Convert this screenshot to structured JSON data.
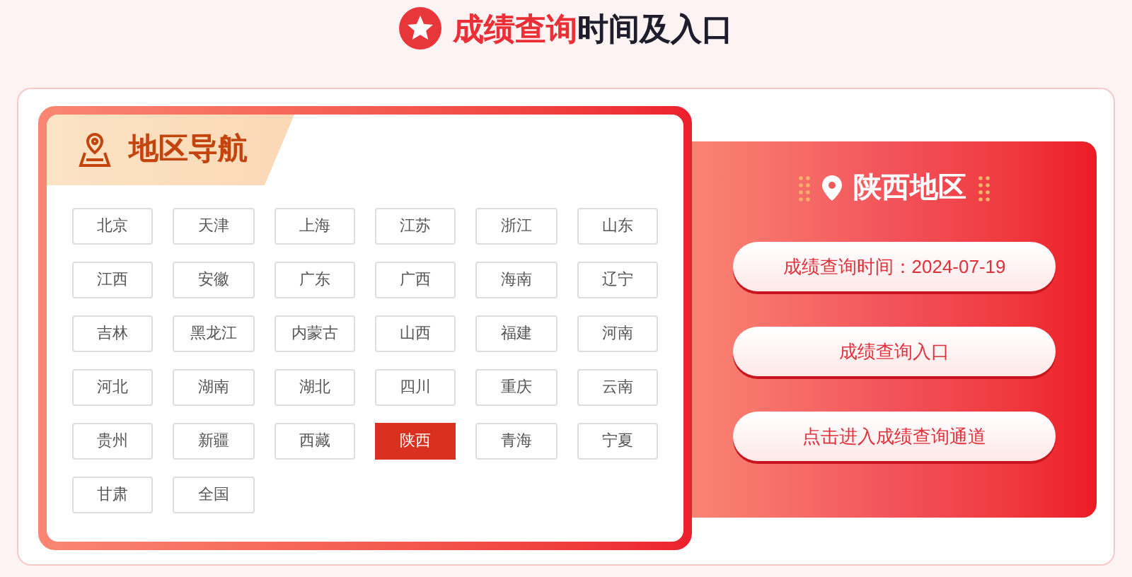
{
  "heading": {
    "highlight": "成绩查询",
    "rest": "时间及入口"
  },
  "region_nav": {
    "title": "地区导航",
    "regions": [
      {
        "name": "北京",
        "selected": false
      },
      {
        "name": "天津",
        "selected": false
      },
      {
        "name": "上海",
        "selected": false
      },
      {
        "name": "江苏",
        "selected": false
      },
      {
        "name": "浙江",
        "selected": false
      },
      {
        "name": "山东",
        "selected": false
      },
      {
        "name": "江西",
        "selected": false
      },
      {
        "name": "安徽",
        "selected": false
      },
      {
        "name": "广东",
        "selected": false
      },
      {
        "name": "广西",
        "selected": false
      },
      {
        "name": "海南",
        "selected": false
      },
      {
        "name": "辽宁",
        "selected": false
      },
      {
        "name": "吉林",
        "selected": false
      },
      {
        "name": "黑龙江",
        "selected": false
      },
      {
        "name": "内蒙古",
        "selected": false
      },
      {
        "name": "山西",
        "selected": false
      },
      {
        "name": "福建",
        "selected": false
      },
      {
        "name": "河南",
        "selected": false
      },
      {
        "name": "河北",
        "selected": false
      },
      {
        "name": "湖南",
        "selected": false
      },
      {
        "name": "湖北",
        "selected": false
      },
      {
        "name": "四川",
        "selected": false
      },
      {
        "name": "重庆",
        "selected": false
      },
      {
        "name": "云南",
        "selected": false
      },
      {
        "name": "贵州",
        "selected": false
      },
      {
        "name": "新疆",
        "selected": false
      },
      {
        "name": "西藏",
        "selected": false
      },
      {
        "name": "陕西",
        "selected": true
      },
      {
        "name": "青海",
        "selected": false
      },
      {
        "name": "宁夏",
        "selected": false
      },
      {
        "name": "甘肃",
        "selected": false
      },
      {
        "name": "全国",
        "selected": false
      }
    ]
  },
  "region_panel": {
    "title": "陕西地区",
    "buttons": [
      "成绩查询时间：2024-07-19",
      "成绩查询入口",
      "点击进入成绩查询通道"
    ]
  }
}
